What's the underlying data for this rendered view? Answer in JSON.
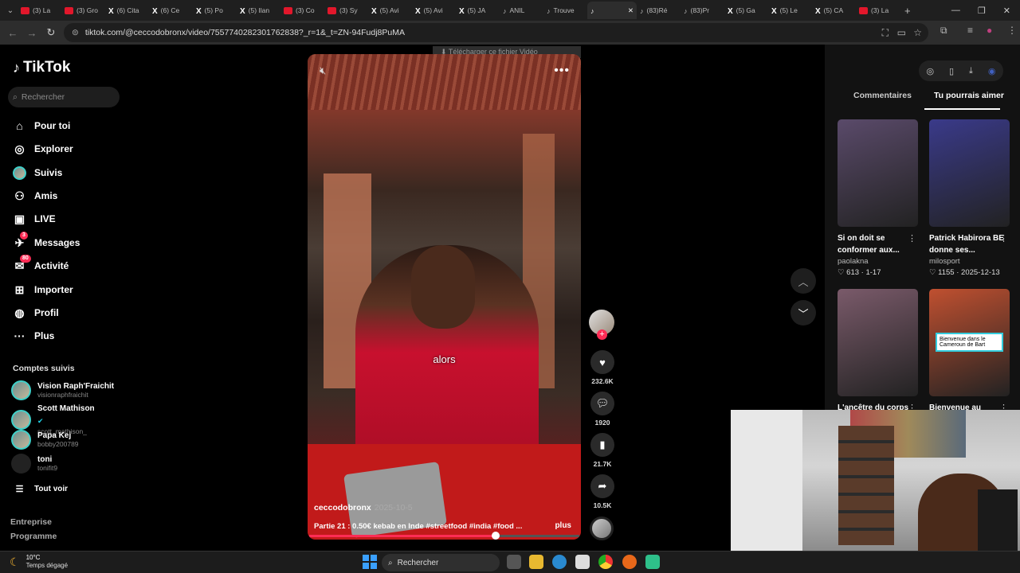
{
  "browser": {
    "tabs": [
      {
        "icon": "youtube-icon",
        "label": "(3) La"
      },
      {
        "icon": "youtube-icon",
        "label": "(3) Gro"
      },
      {
        "icon": "x-icon",
        "label": "(6) Cita"
      },
      {
        "icon": "x-icon",
        "label": "(6) Ce"
      },
      {
        "icon": "x-icon",
        "label": "(5) Po"
      },
      {
        "icon": "x-icon",
        "label": "(5) Ilan"
      },
      {
        "icon": "youtube-icon",
        "label": "(3) Co"
      },
      {
        "icon": "youtube-icon",
        "label": "(3) Sy"
      },
      {
        "icon": "x-icon",
        "label": "(5) Avi"
      },
      {
        "icon": "x-icon",
        "label": "(5) Avi"
      },
      {
        "icon": "x-icon",
        "label": "(5) JA"
      },
      {
        "icon": "tiktok-icon",
        "label": "ANIL"
      },
      {
        "icon": "tiktok-icon",
        "label": "Trouve"
      },
      {
        "icon": "tiktok-icon",
        "label": "",
        "active": true
      },
      {
        "icon": "tiktok-icon",
        "label": "(83)Ré"
      },
      {
        "icon": "tiktok-icon",
        "label": "(83)Pr"
      },
      {
        "icon": "x-icon",
        "label": "(5) Ga"
      },
      {
        "icon": "x-icon",
        "label": "(5) Le"
      },
      {
        "icon": "x-icon",
        "label": "(5) CA"
      },
      {
        "icon": "youtube-icon",
        "label": "(3) La"
      }
    ],
    "url": "tiktok.com/@ceccodobronx/video/7557740282301762838?_r=1&_t=ZN-94Fudj8PuMA",
    "download_bar": "Télécharger ce fichier Vidéo"
  },
  "sidebar": {
    "brand": "TikTok",
    "search_placeholder": "Rechercher",
    "nav": [
      {
        "icon": "home-icon",
        "label": "Pour toi"
      },
      {
        "icon": "compass-icon",
        "label": "Explorer"
      },
      {
        "icon": "avatar-icon",
        "label": "Suivis"
      },
      {
        "icon": "friends-icon",
        "label": "Amis"
      },
      {
        "icon": "live-icon",
        "label": "LIVE"
      },
      {
        "icon": "messages-icon",
        "label": "Messages",
        "badge": "3"
      },
      {
        "icon": "activity-icon",
        "label": "Activité",
        "badge": "80"
      },
      {
        "icon": "upload-icon",
        "label": "Importer"
      },
      {
        "icon": "profile-icon",
        "label": "Profil"
      },
      {
        "icon": "more-icon",
        "label": "Plus"
      }
    ],
    "followed_title": "Comptes suivis",
    "followed": [
      {
        "name": "Vision Raph'Fraichit",
        "handle": "visionraphfraichit"
      },
      {
        "name": "Scott Mathison",
        "handle": "scott_mathison_",
        "verified": true
      },
      {
        "name": "Papa Kej",
        "handle": "bobby200789"
      },
      {
        "name": "toni",
        "handle": "tonifit9"
      }
    ],
    "see_all": "Tout voir",
    "footer": [
      "Entreprise",
      "Programme"
    ]
  },
  "video": {
    "subtitle": "alors",
    "author": "ceccodobronx",
    "date": "2025-10-5",
    "description": "Partie 21 : 0.50€ kebab en Inde #streetfood #india #food ...",
    "more": "plus",
    "progress": 0.69,
    "likes": "232.6K",
    "comments": "1920",
    "saves": "21.7K",
    "shares": "10.5K"
  },
  "right_panel": {
    "tabs": [
      "Commentaires",
      "Tu pourrais aimer"
    ],
    "active_tab": 1,
    "cards": [
      {
        "title": "Si on doit se conformer aux...",
        "author": "paolakna",
        "likes": "613",
        "date": "1-17",
        "thumb": "#5a4a6a"
      },
      {
        "title": "Patrick Habirora BE donne ses...",
        "author": "milosport",
        "likes": "1155",
        "date": "2025-12-13",
        "thumb": "#3a3a8a"
      },
      {
        "title": "L'ancêtre du corps",
        "thumb": "#7a5a6a"
      },
      {
        "title": "Bienvenue au",
        "thumb": "#c05030",
        "overlay": "Bienvenue dans le Cameroun de Bart"
      }
    ]
  },
  "taskbar": {
    "temperature": "10°C",
    "weather": "Temps dégagé",
    "search_label": "Rechercher"
  }
}
